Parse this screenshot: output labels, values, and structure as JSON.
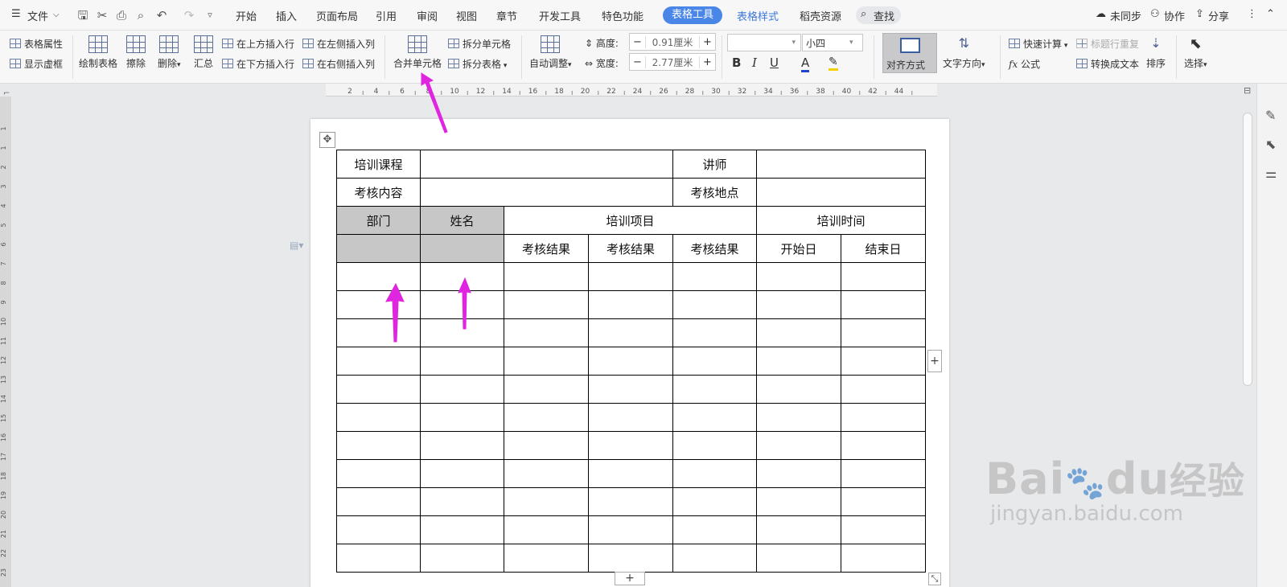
{
  "menu": {
    "file_label": "文件",
    "tabs": [
      "开始",
      "插入",
      "页面布局",
      "引用",
      "审阅",
      "视图",
      "章节",
      "开发工具",
      "特色功能"
    ],
    "active_tab": "表格工具",
    "extra_tabs": [
      "表格样式",
      "稻壳资源"
    ],
    "search_label": "查找",
    "sync_label": "未同步",
    "collab_label": "协作",
    "share_label": "分享"
  },
  "ribbon": {
    "table_props": "表格属性",
    "show_grid": "显示虚框",
    "draw_table": "绘制表格",
    "erase": "擦除",
    "delete": "删除",
    "summary": "汇总",
    "insert_above": "在上方插入行",
    "insert_below": "在下方插入行",
    "insert_left": "在左侧插入列",
    "insert_right": "在右侧插入列",
    "merge_cells": "合并单元格",
    "split_cells": "拆分单元格",
    "split_table": "拆分表格",
    "auto_fit": "自动调整",
    "height_label": "高度:",
    "height_value": "0.91厘米",
    "width_label": "宽度:",
    "width_value": "2.77厘米",
    "font_size": "小四",
    "align": "对齐方式",
    "text_dir": "文字方向",
    "quick_calc": "快速计算",
    "title_repeat": "标题行重复",
    "formula": "公式",
    "to_text": "转换成文本",
    "sort": "排序",
    "select": "选择"
  },
  "ruler": {
    "h_ticks": [
      "2",
      "4",
      "6",
      "8",
      "10",
      "12",
      "14",
      "16",
      "18",
      "20",
      "22",
      "24",
      "26",
      "28",
      "30",
      "32",
      "34",
      "36",
      "38",
      "40",
      "42",
      "44"
    ],
    "v_ticks": [
      "1",
      "1",
      "2",
      "3",
      "4",
      "5",
      "6",
      "7",
      "8",
      "9",
      "10",
      "11",
      "12",
      "13",
      "14",
      "15",
      "16",
      "17",
      "18",
      "19",
      "20",
      "21",
      "22",
      "23"
    ]
  },
  "table": {
    "row1": [
      "培训课程",
      "讲师"
    ],
    "row2": [
      "考核内容",
      "考核地点"
    ],
    "row3": [
      "部门",
      "姓名",
      "培训项目",
      "培训时间"
    ],
    "row4": [
      "考核结果",
      "考核结果",
      "考核结果",
      "开始日",
      "结束日"
    ]
  },
  "watermark": {
    "brand": "Bai",
    "brand2": "du",
    "cn": "经验",
    "url": "jingyan.baidu.com"
  },
  "colors": {
    "accent": "#4a86e8",
    "arrow": "#e025e0",
    "selected_cell": "#c7c7c7"
  }
}
